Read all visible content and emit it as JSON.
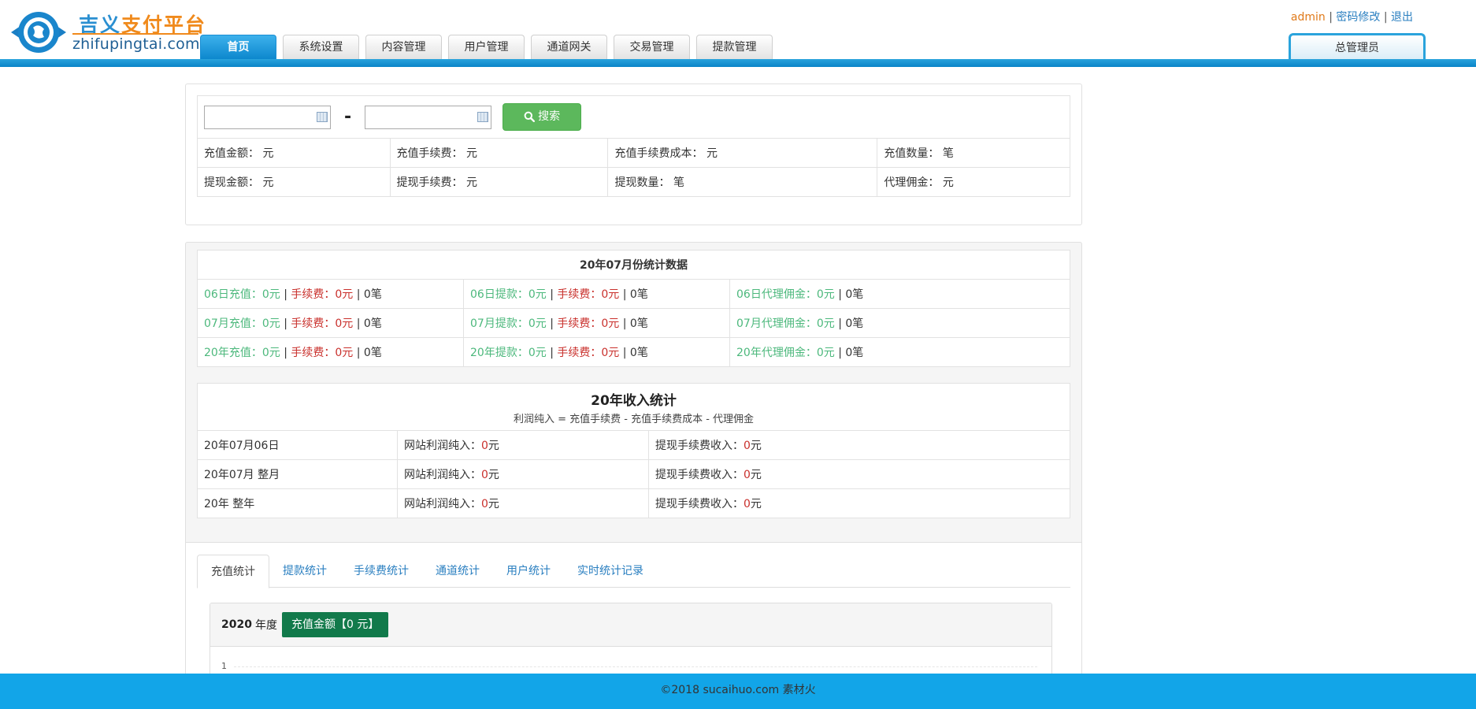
{
  "brand": {
    "name_part1": "吉义",
    "name_part2": "支付平台",
    "url": "zhifupingtai.com"
  },
  "nav": {
    "tabs": [
      {
        "label": "首页",
        "active": true
      },
      {
        "label": "系统设置",
        "active": false
      },
      {
        "label": "内容管理",
        "active": false
      },
      {
        "label": "用户管理",
        "active": false
      },
      {
        "label": "通道网关",
        "active": false
      },
      {
        "label": "交易管理",
        "active": false
      },
      {
        "label": "提款管理",
        "active": false
      }
    ]
  },
  "top_links": {
    "user": "admin",
    "sep1": " | ",
    "change_password": "密码修改",
    "sep2": " | ",
    "logout": "退出"
  },
  "role_tab": "总管理员",
  "search": {
    "start_date": "",
    "end_date": "",
    "dash": "-",
    "button": "搜索",
    "summary_rows": [
      [
        {
          "label": "充值金额：",
          "unit": "元"
        },
        {
          "label": "充值手续费：",
          "unit": "元"
        },
        {
          "label": "充值手续费成本：",
          "unit": "元"
        },
        {
          "label": "充值数量：",
          "unit": "笔"
        }
      ],
      [
        {
          "label": "提现金额：",
          "unit": "元"
        },
        {
          "label": "提现手续费：",
          "unit": "元"
        },
        {
          "label": "提现数量：",
          "unit": "笔"
        },
        {
          "label": "代理佣金：",
          "unit": "元"
        }
      ]
    ]
  },
  "monthly": {
    "title": "20年07月份统计数据",
    "rows": [
      {
        "recharge": {
          "label": "06日充值：",
          "value": "0元",
          "fee_label": "手续费：",
          "fee": "0元",
          "count": "0笔"
        },
        "withdraw": {
          "label": "06日提款：",
          "value": "0元",
          "fee_label": "手续费：",
          "fee": "0元",
          "count": "0笔"
        },
        "commission": {
          "label": "06日代理佣金：",
          "value": "0元",
          "count": "0笔"
        }
      },
      {
        "recharge": {
          "label": "07月充值：",
          "value": "0元",
          "fee_label": "手续费：",
          "fee": "0元",
          "count": "0笔"
        },
        "withdraw": {
          "label": "07月提款：",
          "value": "0元",
          "fee_label": "手续费：",
          "fee": "0元",
          "count": "0笔"
        },
        "commission": {
          "label": "07月代理佣金：",
          "value": "0元",
          "count": "0笔"
        }
      },
      {
        "recharge": {
          "label": "20年充值：",
          "value": "0元",
          "fee_label": "手续费：",
          "fee": "0元",
          "count": "0笔"
        },
        "withdraw": {
          "label": "20年提款：",
          "value": "0元",
          "fee_label": "手续费：",
          "fee": "0元",
          "count": "0笔"
        },
        "commission": {
          "label": "20年代理佣金：",
          "value": "0元",
          "count": "0笔"
        }
      }
    ]
  },
  "income": {
    "title": "20年收入统计",
    "formula": "利润纯入 = 充值手续费 - 充值手续费成本 - 代理佣金",
    "rows": [
      {
        "period": "20年07月06日",
        "profit_label": "网站利润纯入：",
        "profit": "0",
        "profit_unit": "元",
        "fee_label": "提现手续费收入：",
        "fee": "0",
        "fee_unit": "元"
      },
      {
        "period": "20年07月 整月",
        "profit_label": "网站利润纯入：",
        "profit": "0",
        "profit_unit": "元",
        "fee_label": "提现手续费收入：",
        "fee": "0",
        "fee_unit": "元"
      },
      {
        "period": "20年 整年",
        "profit_label": "网站利润纯入：",
        "profit": "0",
        "profit_unit": "元",
        "fee_label": "提现手续费收入：",
        "fee": "0",
        "fee_unit": "元"
      }
    ]
  },
  "stat_tabs": [
    {
      "label": "充值统计",
      "active": true
    },
    {
      "label": "提款统计",
      "active": false
    },
    {
      "label": "手续费统计",
      "active": false
    },
    {
      "label": "通道统计",
      "active": false
    },
    {
      "label": "用户统计",
      "active": false
    },
    {
      "label": "实时统计记录",
      "active": false
    }
  ],
  "chart": {
    "year": "2020",
    "year_unit": "年度",
    "amount_button": "充值金额【0 元】",
    "y_tick": "1"
  },
  "footer": "©2018 sucaihuo.com 素材火",
  "colors": {
    "primary_blue": "#0a84c8",
    "footer_blue": "#12a5e8",
    "green_value": "#4cb87c",
    "red_value": "#c9302c",
    "search_button": "#5cb85c",
    "chart_button": "#127a4b",
    "brand_orange": "#f08a1c"
  }
}
